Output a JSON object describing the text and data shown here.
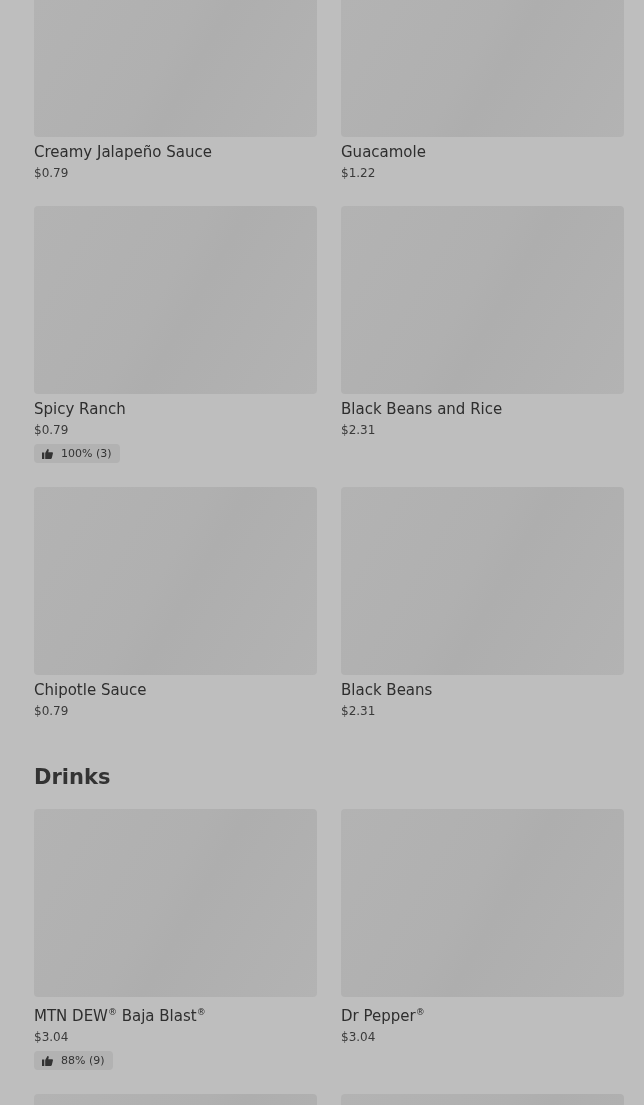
{
  "sections": [
    {
      "items": [
        {
          "kind": "product",
          "name": "Creamy Jalapeño Sauce",
          "price": "$0.79"
        },
        {
          "kind": "product",
          "name": "Guacamole",
          "price": "$1.22"
        },
        {
          "kind": "product",
          "name": "Spicy Ranch",
          "price": "$0.79",
          "rating": "100% (3)"
        },
        {
          "kind": "product",
          "name": "Black Beans and Rice",
          "price": "$2.31"
        },
        {
          "kind": "product",
          "name": "Chipotle Sauce",
          "price": "$0.79"
        },
        {
          "kind": "product",
          "name": "Black Beans",
          "price": "$2.31"
        }
      ]
    },
    {
      "title": "Drinks",
      "items": [
        {
          "kind": "product",
          "name": "MTN DEW$^{®}$ Baja Blast$^{®}$",
          "price": "$3.04",
          "rating": "88% (9)"
        },
        {
          "kind": "product",
          "name": "Dr Pepper$^{®}$",
          "price": "$3.04"
        },
        {
          "kind": "picture"
        },
        {
          "kind": "picture"
        }
      ]
    }
  ]
}
